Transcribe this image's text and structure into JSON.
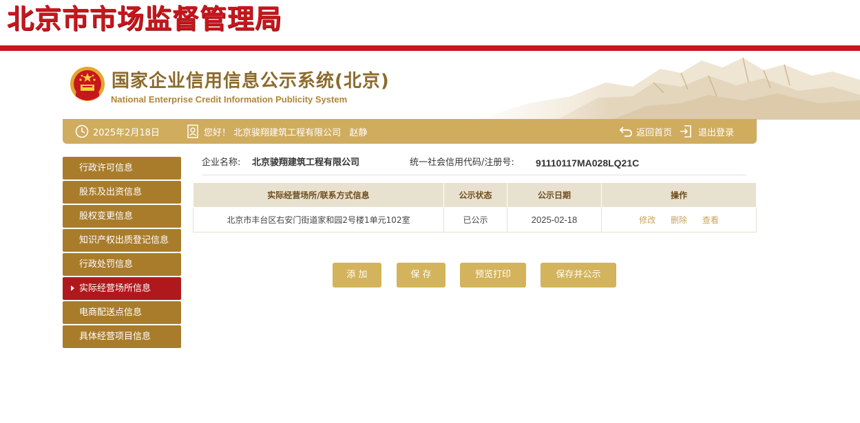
{
  "header": {
    "title": "北京市市场监督管理局",
    "system_title": "国家企业信用信息公示系统(北京)",
    "system_subtitle": "National Enterprise Credit Information Publicity System"
  },
  "topbar": {
    "date": "2025年2月18日",
    "greeting": "您好！ 北京骏翔建筑工程有限公司   赵静",
    "home_label": "返回首页",
    "logout_label": "退出登录"
  },
  "sidebar": {
    "items": [
      {
        "label": "行政许可信息"
      },
      {
        "label": "股东及出资信息"
      },
      {
        "label": "股权变更信息"
      },
      {
        "label": "知识产权出质登记信息"
      },
      {
        "label": "行政处罚信息"
      },
      {
        "label": "实际经营场所信息"
      },
      {
        "label": "电商配送点信息"
      },
      {
        "label": "具体经营项目信息"
      }
    ],
    "active_index": 5
  },
  "company": {
    "name_label": "企业名称:",
    "name": "北京骏翔建筑工程有限公司",
    "code_label": "统一社会信用代码/注册号:",
    "code": "91110117MA028LQ21C"
  },
  "table": {
    "headers": [
      "实际经营场所/联系方式信息",
      "公示状态",
      "公示日期",
      "操作"
    ],
    "rows": [
      {
        "address": "北京市丰台区右安门街道家和园2号楼1单元102室",
        "status": "已公示",
        "date": "2025-02-18",
        "actions": [
          "修改",
          "删除",
          "查看"
        ]
      }
    ]
  },
  "buttons": {
    "add": "添 加",
    "save": "保 存",
    "preview_print": "预览打印",
    "save_publish": "保存并公示"
  },
  "colors": {
    "brand_red": "#c8161d",
    "gold": "#d0ac5f",
    "sidebar_brown": "#a97c2c",
    "active_red": "#b0191c"
  }
}
